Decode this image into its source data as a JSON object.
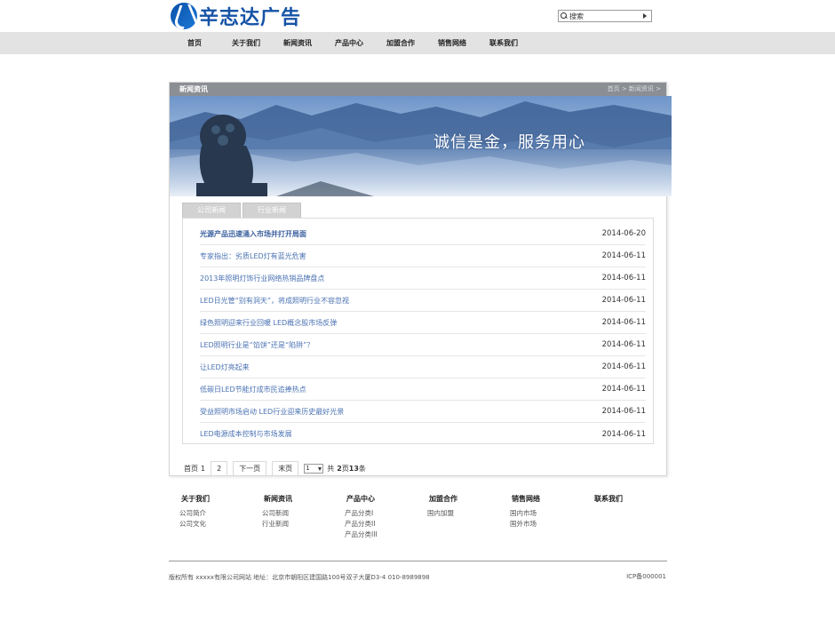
{
  "logo": {
    "text": "辛志达广告"
  },
  "search": {
    "placeholder": "搜索"
  },
  "nav": {
    "items": [
      "首页",
      "关于我们",
      "新闻资讯",
      "产品中心",
      "加盟合作",
      "销售网络",
      "联系我们"
    ]
  },
  "section": {
    "title": "新闻资讯",
    "breadcrumb": "首页 > 新闻资讯 >"
  },
  "banner": {
    "slogan": "诚信是金，服务用心"
  },
  "tabs": [
    "公司新闻",
    "行业新闻"
  ],
  "news": [
    {
      "title": "光源产品迅速涌入市场并打开局面",
      "date": "2014-06-20"
    },
    {
      "title": "专家指出：劣质LED灯有蓝光危害",
      "date": "2014-06-11"
    },
    {
      "title": "2013年照明灯饰行业网络热销品牌盘点",
      "date": "2014-06-11"
    },
    {
      "title": "LED日光管“别有洞天”，将成照明行业不容忽视",
      "date": "2014-06-11"
    },
    {
      "title": "绿色照明迎来行业回暖 LED概念股市场反弹",
      "date": "2014-06-11"
    },
    {
      "title": "LED照明行业是“馅饼”还是“陷阱”？",
      "date": "2014-06-11"
    },
    {
      "title": "让LED灯亮起来",
      "date": "2014-06-11"
    },
    {
      "title": "低碳日LED节能灯成市民追捧热点",
      "date": "2014-06-11"
    },
    {
      "title": "受益照明市场启动 LED行业迎来历史最好光景",
      "date": "2014-06-11"
    },
    {
      "title": "LED电源成本控制与市场发展",
      "date": "2014-06-11"
    }
  ],
  "pager": {
    "first": "首页",
    "current": "1",
    "page2": "2",
    "next": "下一页",
    "last": "末页",
    "select_value": "1",
    "total_prefix": "共",
    "total_pages": "2",
    "pages_word": "页",
    "total_items": "13",
    "items_word": "条"
  },
  "footer": {
    "columns": [
      {
        "head": "关于我们",
        "links": [
          "公司简介",
          "公司文化"
        ]
      },
      {
        "head": "新闻资讯",
        "links": [
          "公司新闻",
          "行业新闻"
        ]
      },
      {
        "head": "产品中心",
        "links": [
          "产品分类I",
          "产品分类II",
          "产品分类III"
        ]
      },
      {
        "head": "加盟合作",
        "links": [
          "国内加盟"
        ]
      },
      {
        "head": "销售网络",
        "links": [
          "国内市场",
          "国外市场"
        ]
      },
      {
        "head": "联系我们",
        "links": []
      }
    ],
    "copyright": "版权所有 xxxxx有限公司网站 地址：北京市朝阳区建国路100号双子大厦D3-4 010-8989898",
    "icp": "ICP备000001"
  },
  "colors": {
    "brand_blue": "#1553a6",
    "nav_bg": "#e3e3e3",
    "title_bar": "#8b8f94",
    "link_blue": "#4a72b3"
  }
}
